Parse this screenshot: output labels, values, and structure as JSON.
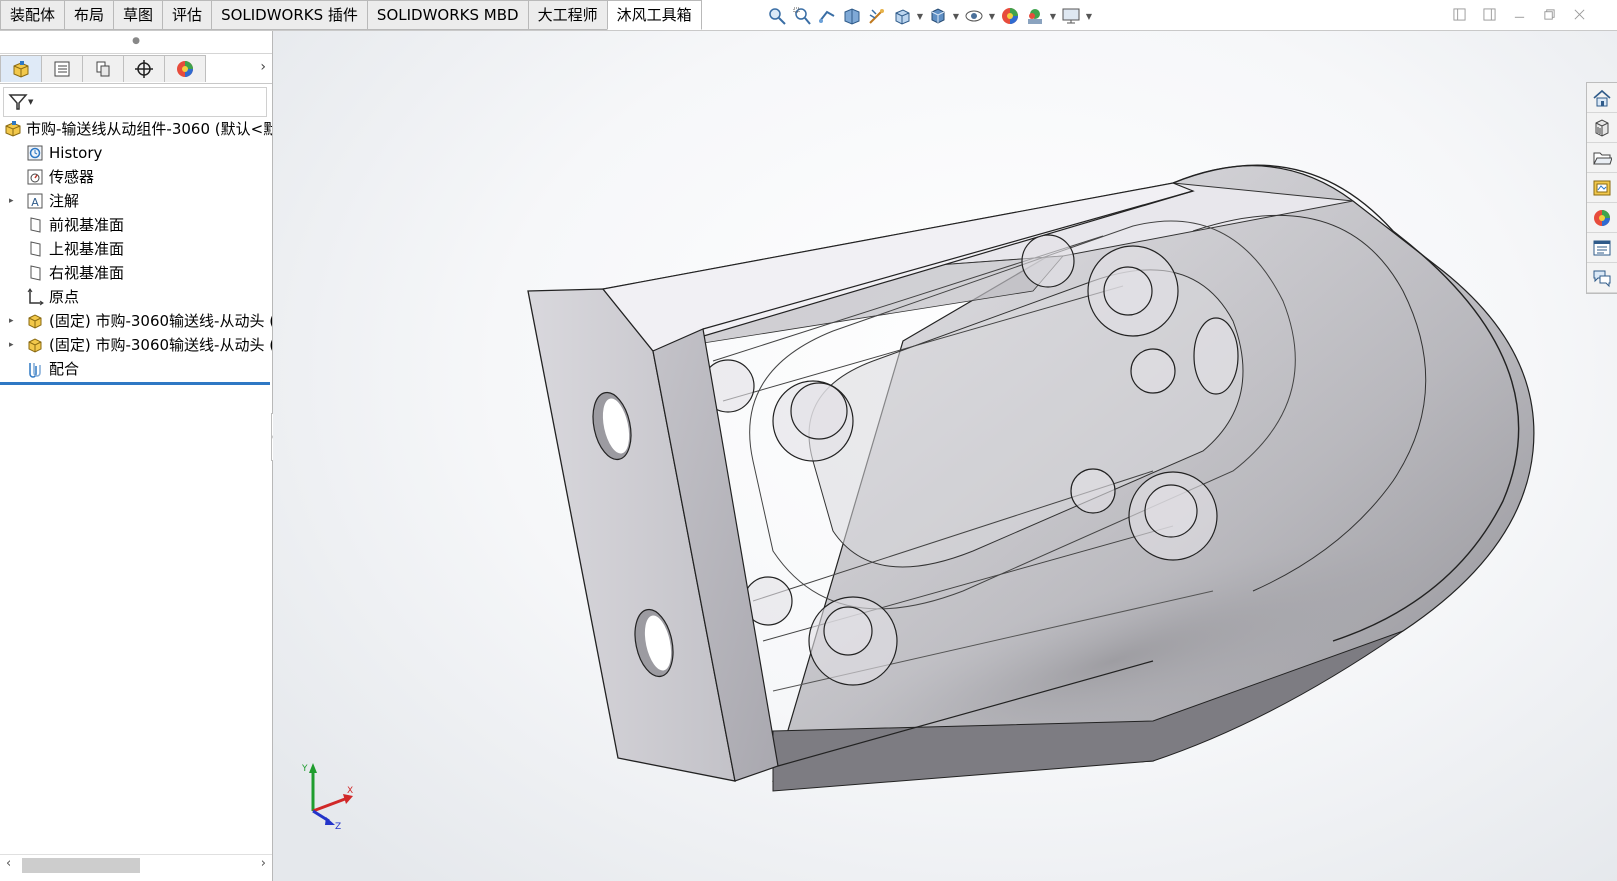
{
  "command_tabs": [
    "装配体",
    "布局",
    "草图",
    "评估",
    "SOLIDWORKS 插件",
    "SOLIDWORKS MBD",
    "大工程师",
    "沐风工具箱"
  ],
  "active_tab_index": 7,
  "heads_up_toolbar": [
    "zoom-to-fit-icon",
    "zoom-to-area-icon",
    "previous-view-icon",
    "section-view-icon",
    "dynamic-annotation-icon",
    "view-orientation-icon",
    "display-style-icon",
    "hide-show-items-icon",
    "edit-appearance-icon",
    "apply-scene-icon",
    "view-settings-icon"
  ],
  "feature_tree": {
    "root": "市购-输送线从动组件-3060  (默认<默",
    "items": [
      {
        "label": "History",
        "icon": "history-icon"
      },
      {
        "label": "传感器",
        "icon": "sensor-icon"
      },
      {
        "label": "注解",
        "icon": "annotation-icon",
        "expandable": true
      },
      {
        "label": "前视基准面",
        "icon": "plane-icon"
      },
      {
        "label": "上视基准面",
        "icon": "plane-icon"
      },
      {
        "label": "右视基准面",
        "icon": "plane-icon"
      },
      {
        "label": "原点",
        "icon": "origin-icon"
      },
      {
        "label": "(固定) 市购-3060输送线-从动头 (",
        "icon": "part-icon",
        "expandable": true
      },
      {
        "label": "(固定) 市购-3060输送线-从动头 (",
        "icon": "part-icon",
        "expandable": true
      },
      {
        "label": "配合",
        "icon": "mates-icon"
      }
    ]
  },
  "triad": {
    "x": "X",
    "y": "Y",
    "z": "Z"
  },
  "task_pane": [
    "home-icon",
    "design-library-icon",
    "file-explorer-icon",
    "view-palette-icon",
    "appearances-icon",
    "custom-properties-icon",
    "forum-icon"
  ],
  "colors": {
    "accent": "#2f78c4",
    "tab_bg": "#ececec",
    "model_face": "#c9c8ce"
  }
}
